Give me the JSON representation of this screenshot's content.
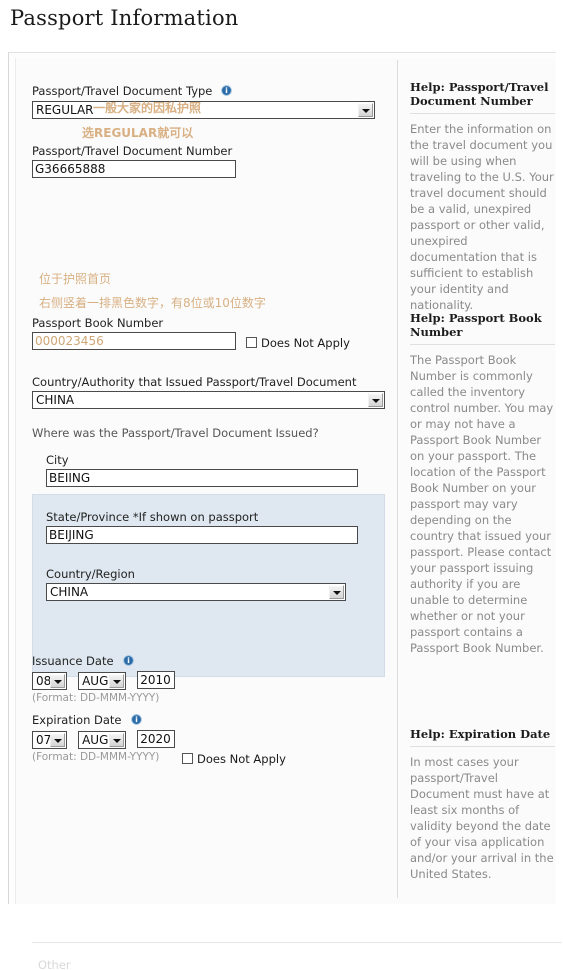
{
  "page": {
    "title": "Passport Information"
  },
  "form": {
    "doc_type": {
      "label": "Passport/Travel Document Type",
      "value": "REGULAR",
      "info_icon": "info-icon",
      "annotation": "一般大家的因私护照",
      "annotation_below": "选REGULAR就可以"
    },
    "doc_number": {
      "label": "Passport/Travel Document Number",
      "value": "G36665888"
    },
    "book_number": {
      "label": "Passport Book Number",
      "value": "000023456",
      "annotation_1": "位于护照首页",
      "annotation_2": "右侧竖着一排黑色数字，有8位或10位数字",
      "not_apply_label": "Does Not Apply",
      "not_apply_checked": false
    },
    "issuing_country": {
      "label": "Country/Authority that Issued Passport/Travel Document",
      "value": "CHINA"
    },
    "issued_where": {
      "question": "Where was the Passport/Travel Document Issued?",
      "city": {
        "label": "City",
        "value": "BEIING"
      },
      "state": {
        "label": "State/Province *If shown on passport",
        "value": "BEIJING"
      },
      "country": {
        "label": "Country/Region",
        "value": "CHINA"
      }
    },
    "issuance_date": {
      "label": "Issuance Date",
      "info_icon": "info-icon",
      "day": "08",
      "month": "AUG",
      "year": "2010",
      "format_hint": "(Format: DD-MMM-YYYY)"
    },
    "expiration_date": {
      "label": "Expiration Date",
      "info_icon": "info-icon",
      "day": "07",
      "month": "AUG",
      "year": "2020",
      "format_hint": "(Format: DD-MMM-YYYY)",
      "not_apply_label": "Does Not Apply",
      "not_apply_checked": false
    }
  },
  "help": {
    "doc_number": {
      "title": "Help: Passport/Travel Document Number",
      "body": "Enter the information on the travel document you will be using when traveling to the U.S. Your travel document should be a valid, unexpired passport or other valid, unexpired documentation that is sufficient to establish your identity and nationality."
    },
    "book_number": {
      "title": "Help: Passport Book Number",
      "body": "The Passport Book Number is commonly called the inventory control number. You may or may not have a Passport Book Number on your passport. The location of the Passport Book Number on your passport may vary depending on the country that issued your passport. Please contact your passport issuing authority if you are unable to determine whether or not your passport contains a Passport Book Number."
    },
    "expiration_date": {
      "title": "Help: Expiration Date",
      "body": "In most cases your passport/Travel Document must have at least six months of validity beyond the date of your visa application and/or your arrival in the United States."
    }
  },
  "footer": {
    "cut_text": "Other"
  },
  "colors": {
    "annotation": "#d8b083",
    "panel_blue": "#dfe8f0",
    "help_text": "#8a8a8a"
  }
}
